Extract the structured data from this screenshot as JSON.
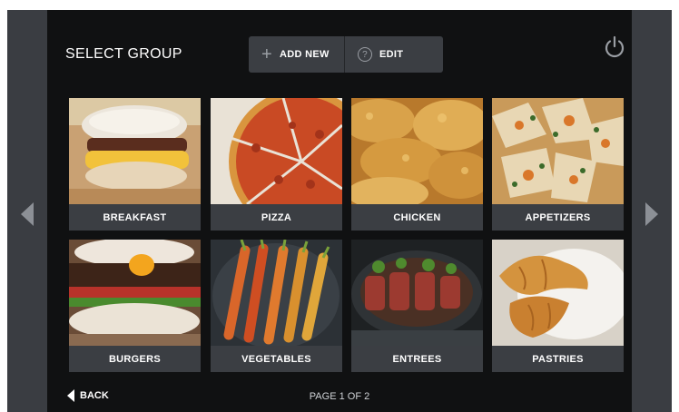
{
  "header": {
    "title": "SELECT GROUP",
    "add_label": "ADD NEW",
    "edit_label": "EDIT"
  },
  "groups": [
    {
      "label": "BREAKFAST",
      "icon": "breakfast-photo"
    },
    {
      "label": "PIZZA",
      "icon": "pizza-photo"
    },
    {
      "label": "CHICKEN",
      "icon": "chicken-photo"
    },
    {
      "label": "APPETIZERS",
      "icon": "appetizers-photo"
    },
    {
      "label": "BURGERS",
      "icon": "burgers-photo"
    },
    {
      "label": "VEGETABLES",
      "icon": "vegetables-photo"
    },
    {
      "label": "ENTREES",
      "icon": "entrees-photo"
    },
    {
      "label": "PASTRIES",
      "icon": "pastries-photo"
    }
  ],
  "footer": {
    "back_label": "BACK",
    "page_indicator": "PAGE 1 OF 2"
  },
  "colors": {
    "background": "#101112",
    "panel": "#3b3e43",
    "side": "#3a3d42",
    "text": "#ffffff"
  }
}
